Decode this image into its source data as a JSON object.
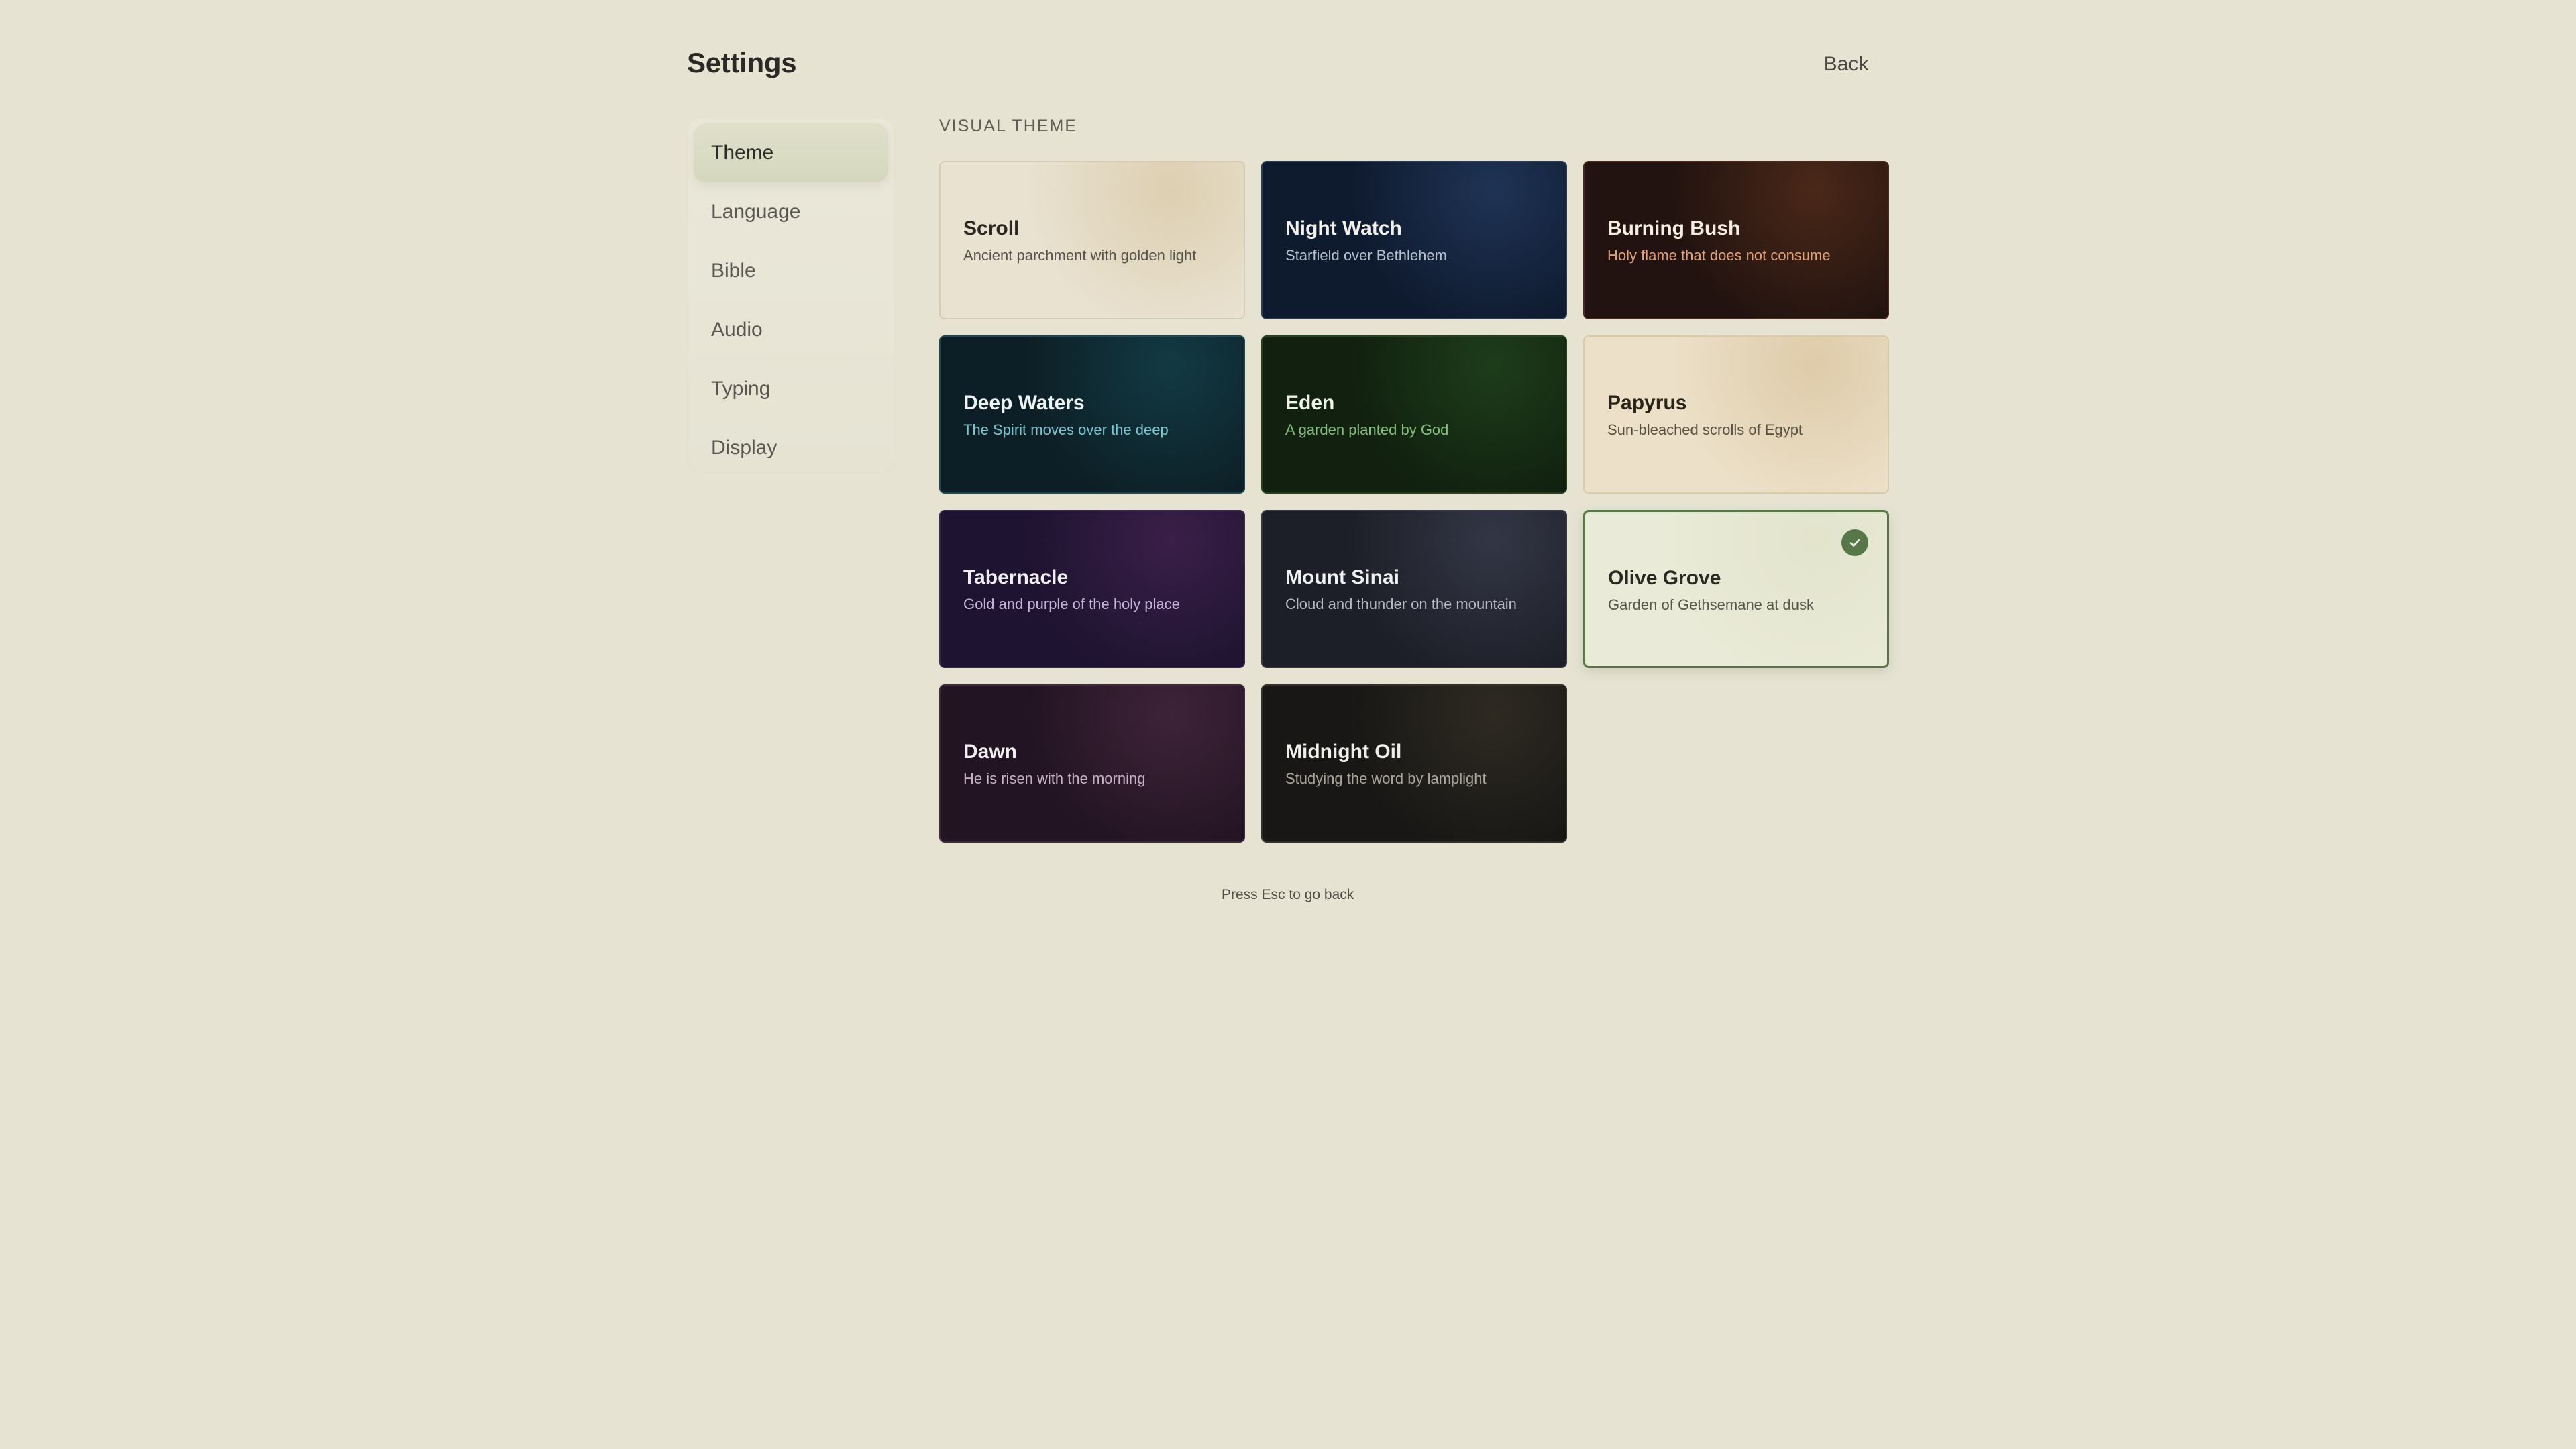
{
  "header": {
    "title": "Settings",
    "back_label": "Back"
  },
  "sidebar": {
    "items": [
      {
        "label": "Theme",
        "active": true
      },
      {
        "label": "Language",
        "active": false
      },
      {
        "label": "Bible",
        "active": false
      },
      {
        "label": "Audio",
        "active": false
      },
      {
        "label": "Typing",
        "active": false
      },
      {
        "label": "Display",
        "active": false
      }
    ]
  },
  "main": {
    "section_label": "VISUAL THEME",
    "themes": [
      {
        "name": "Scroll",
        "description": "Ancient parchment with golden light",
        "background": "#e9e2d1",
        "glow": "#ddcfb1",
        "border": "#d6ccb6",
        "name_color": "#2a2620",
        "desc_color": "#57524a",
        "selected": false
      },
      {
        "name": "Night Watch",
        "description": "Starfield over Bethlehem",
        "background": "#0e1a2e",
        "glow": "#1f3355",
        "border": "#2d3a50",
        "name_color": "#f2f0ea",
        "desc_color": "#b7c0cf",
        "selected": false
      },
      {
        "name": "Burning Bush",
        "description": "Holy flame that does not consume",
        "background": "#221310",
        "glow": "#4a2818",
        "border": "#4a2a1f",
        "name_color": "#f6ece2",
        "desc_color": "#e3a27a",
        "selected": false
      },
      {
        "name": "Deep Waters",
        "description": "The Spirit moves over the deep",
        "background": "#0d1f26",
        "glow": "#123a44",
        "border": "#204650",
        "name_color": "#eef5f6",
        "desc_color": "#79c7d0",
        "selected": false
      },
      {
        "name": "Eden",
        "description": "A garden planted by God",
        "background": "#11200f",
        "glow": "#1d3d1a",
        "border": "#27401f",
        "name_color": "#eef3ea",
        "desc_color": "#86bf7d",
        "selected": false
      },
      {
        "name": "Papyrus",
        "description": "Sun-bleached scrolls of Egypt",
        "background": "#ece0c8",
        "glow": "#decba9",
        "border": "#d9caa8",
        "name_color": "#2a2418",
        "desc_color": "#57503f",
        "selected": false
      },
      {
        "name": "Tabernacle",
        "description": "Gold and purple of the holy place",
        "background": "#1e1330",
        "glow": "#3a1f48",
        "border": "#3a2a4a",
        "name_color": "#f1eef5",
        "desc_color": "#c5b4d9",
        "selected": false
      },
      {
        "name": "Mount Sinai",
        "description": "Cloud and thunder on the mountain",
        "background": "#1d1f28",
        "glow": "#333645",
        "border": "#363844",
        "name_color": "#f0f0f2",
        "desc_color": "#b6b8c2",
        "selected": false
      },
      {
        "name": "Olive Grove",
        "description": "Garden of Gethsemane at dusk",
        "background": "#e9ead7",
        "glow": "#e3e4cc",
        "border": "#577749",
        "name_color": "#2a2a22",
        "desc_color": "#56564b",
        "selected": true
      },
      {
        "name": "Dawn",
        "description": "He is risen with the morning",
        "background": "#221423",
        "glow": "#3e2338",
        "border": "#3e2a3c",
        "name_color": "#f3eef2",
        "desc_color": "#c8b2c6",
        "selected": false
      },
      {
        "name": "Midnight Oil",
        "description": "Studying the word by lamplight",
        "background": "#181715",
        "glow": "#2e2a22",
        "border": "#33302a",
        "name_color": "#f1efe9",
        "desc_color": "#aaa69c",
        "selected": false
      }
    ]
  },
  "footer": {
    "hint": "Press Esc to go back"
  }
}
